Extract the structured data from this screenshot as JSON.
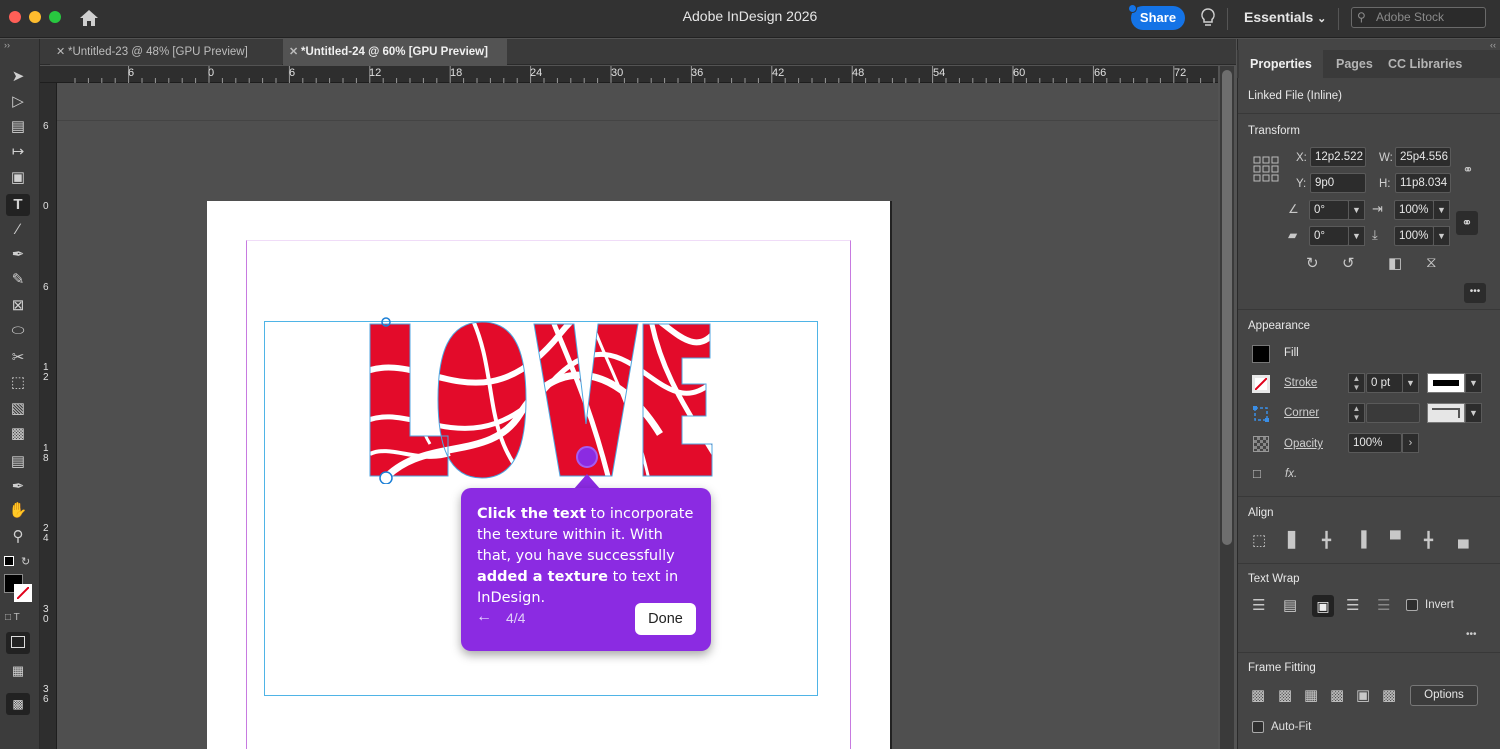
{
  "app": {
    "title": "Adobe InDesign 2026"
  },
  "titlebar": {
    "share_label": "Share",
    "workspace_label": "Essentials",
    "stock_placeholder": "Adobe Stock"
  },
  "doc_tabs": [
    {
      "label": "*Untitled-23 @ 48% [GPU Preview]",
      "active": false
    },
    {
      "label": "*Untitled-24 @ 60% [GPU Preview]",
      "active": true
    }
  ],
  "ruler": {
    "horizontal": [
      "6",
      "0",
      "6",
      "12",
      "18",
      "24",
      "30",
      "36",
      "42",
      "48",
      "54",
      "60",
      "66",
      "72"
    ],
    "vertical": [
      "6",
      "0",
      "6",
      "1 2",
      "1 8",
      "2 4",
      "3 0",
      "3 6"
    ]
  },
  "artwork": {
    "word": "LOVE",
    "fill_color": "#e30b2a"
  },
  "tooltip": {
    "bold1": "Click the text",
    "text1": " to incorporate the texture within it. With that, you have successfully ",
    "bold2": "added a texture",
    "text2": " to text in InDesign.",
    "back_icon": "←",
    "counter": "4/4",
    "done_label": "Done"
  },
  "panel": {
    "tabs": [
      "Properties",
      "Pages",
      "CC Libraries"
    ],
    "selection_label": "Linked File (Inline)",
    "transform": {
      "title": "Transform",
      "x_label": "X:",
      "x_value": "12p2.522",
      "y_label": "Y:",
      "y_value": "9p0",
      "w_label": "W:",
      "w_value": "25p4.556",
      "h_label": "H:",
      "h_value": "11p8.034",
      "rotation": "0°",
      "shear": "0°",
      "scale_x": "100%",
      "scale_y": "100%"
    },
    "appearance": {
      "title": "Appearance",
      "fill_label": "Fill",
      "stroke_label": "Stroke",
      "stroke_value": "0 pt",
      "corner_label": "Corner",
      "opacity_label": "Opacity",
      "opacity_value": "100%",
      "fx_label": "fx."
    },
    "align": {
      "title": "Align"
    },
    "text_wrap": {
      "title": "Text Wrap",
      "invert_label": "Invert"
    },
    "frame_fitting": {
      "title": "Frame Fitting",
      "options_label": "Options",
      "autofit_label": "Auto-Fit"
    },
    "more_icon": "•••"
  }
}
